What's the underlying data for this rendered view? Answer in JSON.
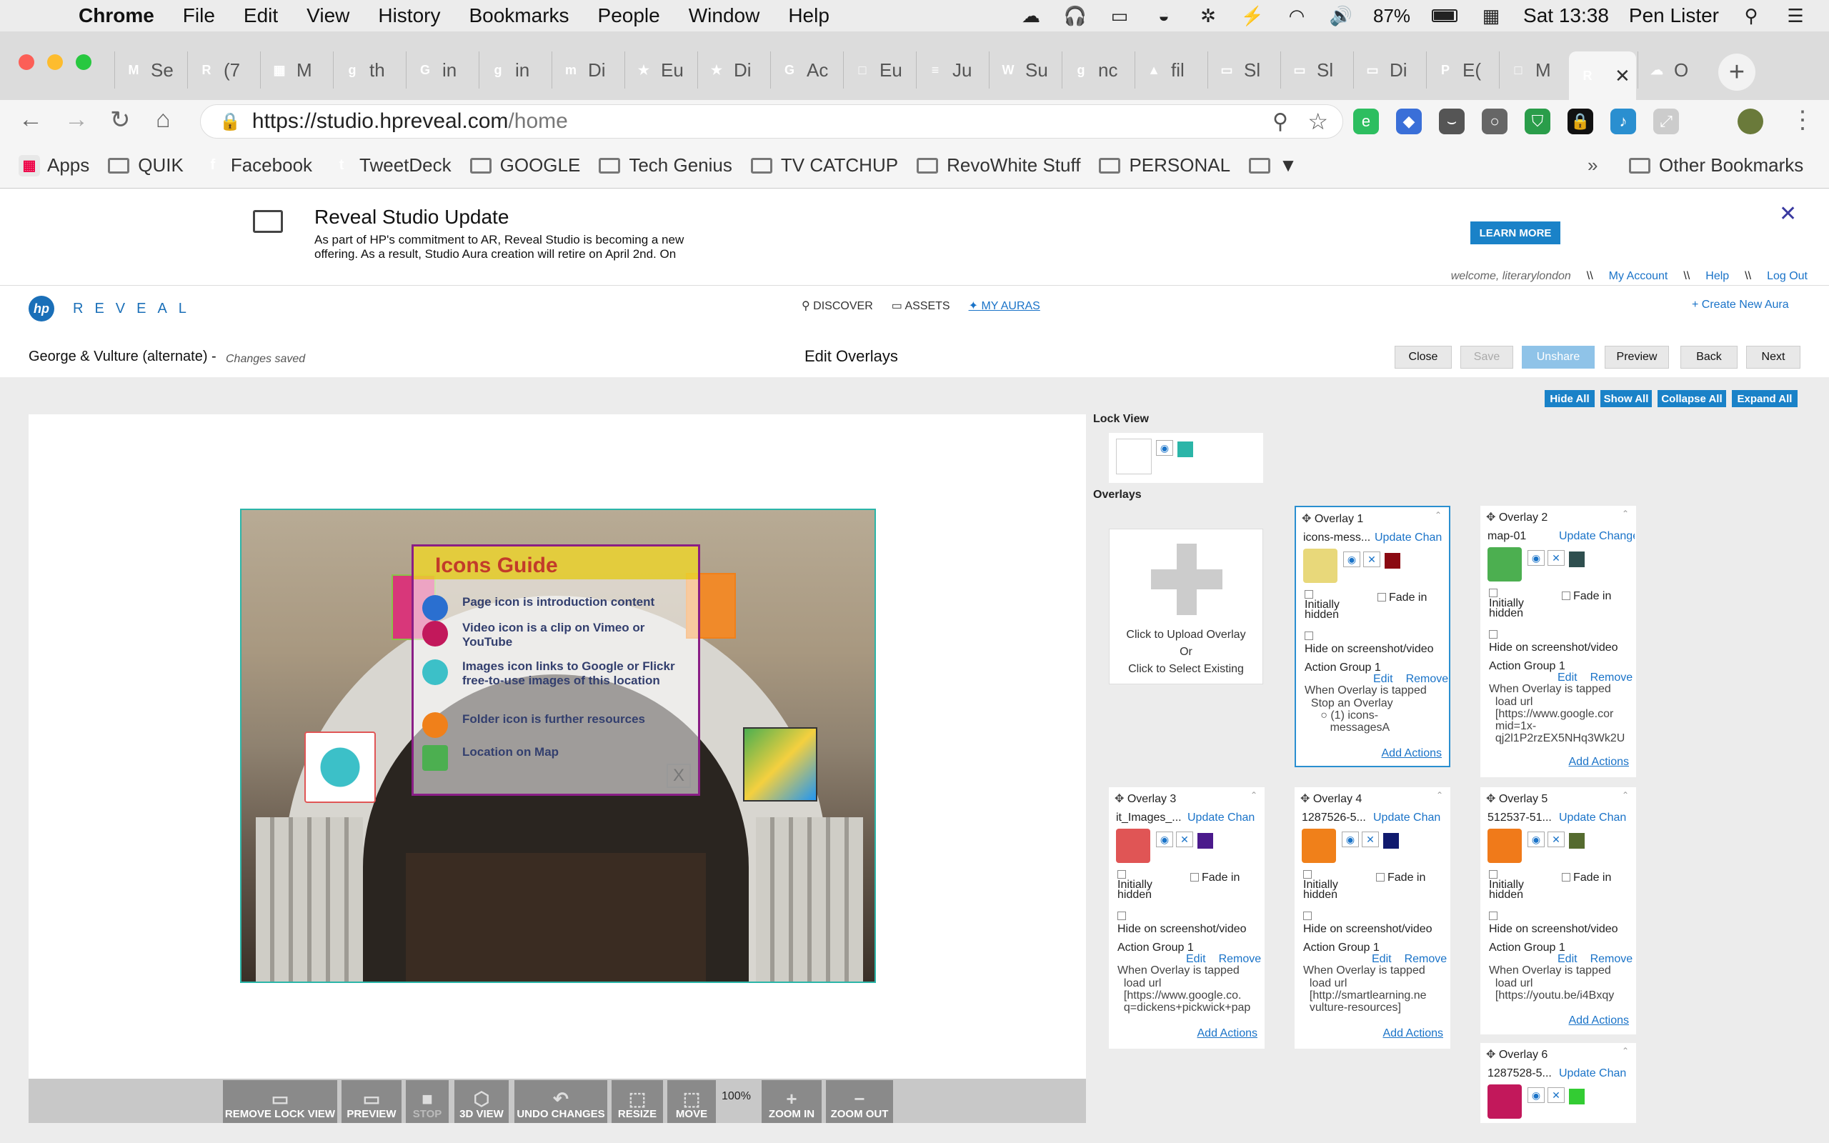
{
  "menubar": {
    "app": "Chrome",
    "items": [
      "File",
      "Edit",
      "View",
      "History",
      "Bookmarks",
      "People",
      "Window",
      "Help"
    ],
    "battery": "87%",
    "clock": "Sat 13:38",
    "user": "Pen Lister"
  },
  "tabs": [
    {
      "label": "Se",
      "color": "#d93025",
      "glyph": "M"
    },
    {
      "label": "(7",
      "color": "#1fb59a",
      "glyph": "R"
    },
    {
      "label": "M",
      "color": "#2a5db0",
      "glyph": "▦"
    },
    {
      "label": "th",
      "color": "#3b7de0",
      "glyph": "g"
    },
    {
      "label": "in",
      "color": "#4285f4",
      "glyph": "G"
    },
    {
      "label": "in",
      "color": "#3b7de0",
      "glyph": "g"
    },
    {
      "label": "Di",
      "color": "#c2185b",
      "glyph": "m"
    },
    {
      "label": "Eu",
      "color": "#1a3e9c",
      "glyph": "★"
    },
    {
      "label": "Di",
      "color": "#1a3e9c",
      "glyph": "★"
    },
    {
      "label": "Ac",
      "color": "#2e8b57",
      "glyph": "G"
    },
    {
      "label": "Eu",
      "color": "#888888",
      "glyph": "□"
    },
    {
      "label": "Ju",
      "color": "#4a78d4",
      "glyph": "≡"
    },
    {
      "label": "Su",
      "color": "#333333",
      "glyph": "W"
    },
    {
      "label": "nc",
      "color": "#3b7de0",
      "glyph": "g"
    },
    {
      "label": "fil",
      "color": "#0f9d58",
      "glyph": "▲"
    },
    {
      "label": "Sl",
      "color": "#f4b400",
      "glyph": "▭"
    },
    {
      "label": "Sl",
      "color": "#f4b400",
      "glyph": "▭"
    },
    {
      "label": "Di",
      "color": "#f4b400",
      "glyph": "▭"
    },
    {
      "label": "E(",
      "color": "#d93025",
      "glyph": "P"
    },
    {
      "label": "M",
      "color": "#888888",
      "glyph": "□"
    },
    {
      "label": "",
      "color": "#2a8fd0",
      "glyph": "R"
    },
    {
      "label": "O",
      "color": "#5a8fc0",
      "glyph": "☁"
    }
  ],
  "omnibox": {
    "host": "https://studio.hpreveal.com",
    "path": "/home"
  },
  "bookmarks": [
    {
      "label": "Apps",
      "type": "apps"
    },
    {
      "label": "QUIK",
      "type": "folder"
    },
    {
      "label": "Facebook",
      "type": "fav",
      "color": "#3b5998",
      "glyph": "f"
    },
    {
      "label": "TweetDeck",
      "type": "fav",
      "color": "#1da1f2",
      "glyph": "t"
    },
    {
      "label": "GOOGLE",
      "type": "folder"
    },
    {
      "label": "Tech Genius",
      "type": "folder"
    },
    {
      "label": "TV CATCHUP",
      "type": "folder"
    },
    {
      "label": "RevoWhite Stuff",
      "type": "folder"
    },
    {
      "label": "PERSONAL",
      "type": "folder"
    },
    {
      "label": "▼",
      "type": "folder"
    }
  ],
  "bookmarks_more": "»",
  "bookmarks_other": "Other Bookmarks",
  "banner": {
    "title": "Reveal Studio Update",
    "text": "As part of HP's commitment to AR, Reveal Studio is becoming a new offering. As a result, Studio Aura creation will retire on April 2nd. On",
    "learn_more": "LEARN MORE"
  },
  "user": {
    "welcome": "welcome, literarylondon",
    "sep": "\\\\",
    "my_account": "My Account",
    "help": "Help",
    "log_out": "Log Out"
  },
  "brand": {
    "logo": "hp",
    "name": "REVEAL"
  },
  "nav": {
    "discover": "DISCOVER",
    "assets": "ASSETS",
    "my_auras": "MY AURAS",
    "create": "+ Create New Aura"
  },
  "header": {
    "project": "George & Vulture (alternate) -",
    "status": "Changes saved",
    "title": "Edit Overlays",
    "close": "Close",
    "save": "Save",
    "unshare": "Unshare",
    "preview": "Preview",
    "back": "Back",
    "next": "Next"
  },
  "panel_buttons": {
    "hide_all": "Hide All",
    "show_all": "Show All",
    "collapse_all": "Collapse All",
    "expand_all": "Expand All"
  },
  "guide": {
    "title": "Icons Guide",
    "items": [
      "Page icon is introduction content",
      "Video icon is a clip on Vimeo or YouTube",
      "Images icon links to Google or Flickr free-to-use images of this location",
      "Folder icon is further resources",
      "Location on Map"
    ],
    "close": "X"
  },
  "bottom_toolbar": {
    "remove_lock_view": "REMOVE LOCK VIEW",
    "preview": "PREVIEW",
    "stop": "STOP",
    "view3d": "3D VIEW",
    "undo": "UNDO CHANGES",
    "resize": "RESIZE",
    "move": "MOVE",
    "zoom_level": "100%",
    "zoom_in": "ZOOM IN",
    "zoom_out": "ZOOM OUT"
  },
  "lock_view": {
    "heading": "Lock View",
    "color": "#2bb5a8"
  },
  "overlays_heading": "Overlays",
  "upload": {
    "line1": "Click to Upload Overlay",
    "line2": "Or",
    "line3": "Click to Select Existing"
  },
  "common": {
    "fade_in": "Fade in",
    "initially_hidden": "Initially hidden",
    "hide_screenshot": "Hide on screenshot/video",
    "action_group": "Action Group 1",
    "edit": "Edit",
    "remove": "Remove",
    "when_tapped": "When Overlay is tapped",
    "add_actions": "Add Actions"
  },
  "cards": [
    {
      "title": "Overlay 1",
      "file": "icons-mess...",
      "update": "Update Chan",
      "swatch": "#8b0a12",
      "thumb": "#e8d87a",
      "action": "  Stop an Overlay\n     ○ (1) icons-\n        messagesA",
      "selected": true
    },
    {
      "title": "Overlay 2",
      "file": "map-01",
      "update": "Update Change",
      "swatch": "#2f4f4f",
      "thumb": "#4caf50",
      "action": "  load url\n  [https://www.google.cor\n  mid=1x-\n  qj2l1P2rzEX5NHq3Wk2U",
      "selected": false
    },
    {
      "title": "Overlay 3",
      "file": "it_Images_...",
      "update": "Update Chan",
      "swatch": "#4b1a8c",
      "thumb": "#e05555",
      "action": "  load url\n  [https://www.google.co.\n  q=dickens+pickwick+pap",
      "selected": false
    },
    {
      "title": "Overlay 4",
      "file": "1287526-5...",
      "update": "Update Chan",
      "swatch": "#101a6e",
      "thumb": "#f0801a",
      "action": "  load url\n  [http://smartlearning.ne\n  vulture-resources]",
      "selected": false
    },
    {
      "title": "Overlay 5",
      "file": "512537-51...",
      "update": "Update Chan",
      "swatch": "#556b2f",
      "thumb": "#f07a1a",
      "action": "  load url\n  [https://youtu.be/i4Bxqy",
      "selected": false
    },
    {
      "title": "Overlay 6",
      "file": "1287528-5...",
      "update": "Update Chan",
      "swatch": "#33cc33",
      "thumb": "#c2185b",
      "action": "",
      "selected": false
    }
  ]
}
